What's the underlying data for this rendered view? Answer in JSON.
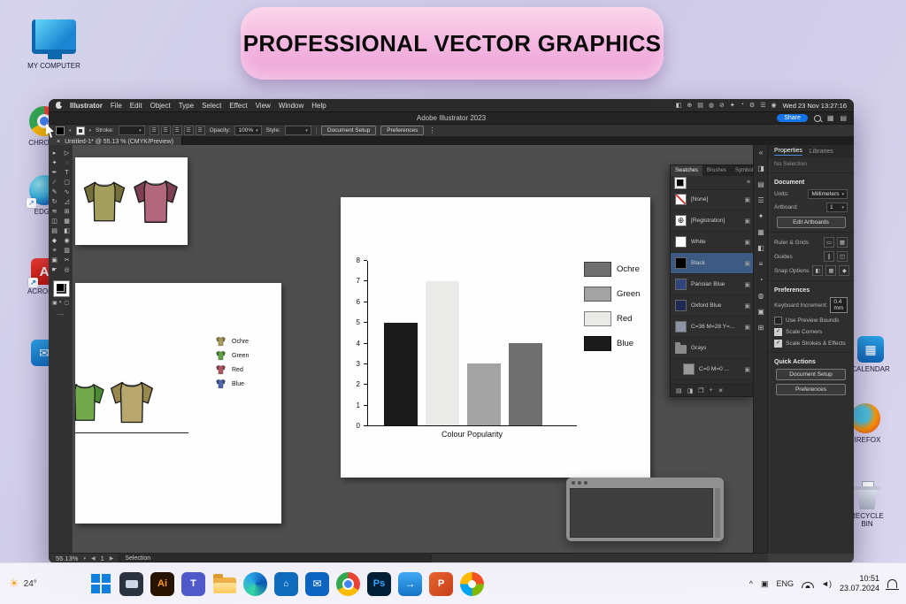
{
  "banner": {
    "title": "PROFESSIONAL VECTOR GRAPHICS"
  },
  "desktop": {
    "my_computer": "MY COMPUTER",
    "left_icons": [
      {
        "name": "chrome",
        "label": "CHROME"
      },
      {
        "name": "edge",
        "label": "EDGE"
      },
      {
        "name": "acrobat",
        "label": "ACROBAT"
      },
      {
        "name": "mail",
        "label": ""
      }
    ],
    "right_icons": [
      {
        "name": "calendar",
        "label": "CALENDAR"
      },
      {
        "name": "firefox",
        "label": "FIREFOX"
      },
      {
        "name": "recycle-bin",
        "label": "RECYCLE BIN"
      }
    ]
  },
  "menubar": {
    "items": [
      "Illustrator",
      "File",
      "Edit",
      "Object",
      "Type",
      "Select",
      "Effect",
      "View",
      "Window",
      "Help"
    ],
    "status_icons": [
      "◧",
      "⊕",
      "▤",
      "◍",
      "⊘",
      "✦",
      "◔",
      "⚙",
      "☰",
      "◉"
    ],
    "clock": "Wed 23 Nov 13:27:16"
  },
  "titlebar": {
    "title": "Adobe Illustrator 2023",
    "share": "Share"
  },
  "controlbar": {
    "stroke_label": "Stroke:",
    "opacity_label": "Opacity:",
    "opacity_value": "100%",
    "style_label": "Style:",
    "doc_setup": "Document Setup",
    "preferences": "Preferences"
  },
  "tab": {
    "close": "×",
    "title": "Untitled-1* @ 55.13 % (CMYK/Preview)"
  },
  "tools": [
    {
      "name": "selection",
      "glyph": "▸"
    },
    {
      "name": "direct-selection",
      "glyph": "▷"
    },
    {
      "name": "magic-wand",
      "glyph": "✦"
    },
    {
      "name": "lasso",
      "glyph": "◌"
    },
    {
      "name": "pen",
      "glyph": "✒"
    },
    {
      "name": "type",
      "glyph": "T"
    },
    {
      "name": "line-segment",
      "glyph": "∕"
    },
    {
      "name": "rectangle",
      "glyph": "▢"
    },
    {
      "name": "paintbrush",
      "glyph": "✎"
    },
    {
      "name": "shaper",
      "glyph": "∿"
    },
    {
      "name": "rotate",
      "glyph": "↻"
    },
    {
      "name": "scale",
      "glyph": "◿"
    },
    {
      "name": "width",
      "glyph": "≋"
    },
    {
      "name": "free-transform",
      "glyph": "⊞"
    },
    {
      "name": "shape-builder",
      "glyph": "◫"
    },
    {
      "name": "perspective-grid",
      "glyph": "▦"
    },
    {
      "name": "mesh",
      "glyph": "▤"
    },
    {
      "name": "gradient",
      "glyph": "◧"
    },
    {
      "name": "eyedropper",
      "glyph": "◆"
    },
    {
      "name": "blend",
      "glyph": "◉"
    },
    {
      "name": "symbol-sprayer",
      "glyph": "≡"
    },
    {
      "name": "column-graph",
      "glyph": "▥"
    },
    {
      "name": "artboard",
      "glyph": "▣"
    },
    {
      "name": "slice",
      "glyph": "✂"
    },
    {
      "name": "hand",
      "glyph": "☛"
    },
    {
      "name": "zoom",
      "glyph": "◎"
    }
  ],
  "dock_icons": [
    {
      "name": "collapse-dock-icon",
      "glyph": "«"
    },
    {
      "name": "color-panel-icon",
      "glyph": "◨"
    },
    {
      "name": "color-guide-panel-icon",
      "glyph": "▤"
    },
    {
      "name": "properties-panel-icon",
      "glyph": "☰"
    },
    {
      "name": "brushes-panel-icon",
      "glyph": "✦"
    },
    {
      "name": "swatches-panel-icon",
      "glyph": "▦"
    },
    {
      "name": "symbols-panel-icon",
      "glyph": "◧"
    },
    {
      "name": "stroke-panel-icon",
      "glyph": "≡"
    },
    {
      "name": "gradient-panel-icon",
      "glyph": "◔"
    },
    {
      "name": "transparency-panel-icon",
      "glyph": "◍"
    },
    {
      "name": "appearance-panel-icon",
      "glyph": "▣"
    },
    {
      "name": "layers-panel-icon",
      "glyph": "⊞"
    }
  ],
  "swatches": {
    "tabs": [
      "Swatches",
      "Brushes",
      "Symbols"
    ],
    "active_tab": "Swatches",
    "rows": [
      {
        "name": "[None]",
        "type": "none"
      },
      {
        "name": "[Registration]",
        "type": "registration"
      },
      {
        "name": "White",
        "type": "color",
        "color": "#ffffff"
      },
      {
        "name": "Black",
        "type": "color",
        "color": "#000000",
        "selected": true
      },
      {
        "name": "Parisian Blue",
        "type": "color",
        "color": "#30457c"
      },
      {
        "name": "Oxford Blue",
        "type": "color",
        "color": "#1e2b55"
      },
      {
        "name": "C=36 M=28 Y=...",
        "type": "color",
        "color": "#8b93a6"
      },
      {
        "name": "Grays",
        "type": "folder"
      },
      {
        "name": "C=0 M=0 ...",
        "type": "color",
        "color": "#9a9a9a",
        "indent": true
      }
    ],
    "footer_icons": [
      "▤",
      "◨",
      "❐",
      "+",
      "✕"
    ]
  },
  "properties": {
    "tabs": [
      "Properties",
      "Libraries"
    ],
    "selection_status": "No Selection",
    "section_document": "Document",
    "units_label": "Units:",
    "units_value": "Millimeters",
    "artboard_label": "Artboard:",
    "artboard_value": "1",
    "edit_artboards": "Edit Artboards",
    "ruler_grids": "Ruler & Grids",
    "guides": "Guides",
    "snap_options": "Snap Options",
    "section_preferences": "Preferences",
    "keyboard_increment_label": "Keyboard Increment:",
    "keyboard_increment_value": "0.4 mm",
    "checkboxes": [
      {
        "label": "Use Preview Bounds",
        "checked": false
      },
      {
        "label": "Scale Corners",
        "checked": true
      },
      {
        "label": "Scale Strokes & Effects",
        "checked": true
      }
    ],
    "section_quick_actions": "Quick Actions",
    "quick_actions": [
      "Document Setup",
      "Preferences"
    ]
  },
  "statusbar": {
    "zoom": "55.13%",
    "artboard": "1",
    "tool": "Selection"
  },
  "chart_data": {
    "type": "bar",
    "title": "",
    "xlabel": "Colour Popularity",
    "ylabel": "",
    "ylim": [
      0,
      8
    ],
    "yticks": [
      0,
      1,
      2,
      3,
      4,
      5,
      6,
      7,
      8
    ],
    "categories": [
      "Blue",
      "Red",
      "Green",
      "Ochre"
    ],
    "values": [
      5,
      7,
      3,
      4
    ],
    "bar_colors": [
      "#1b1b1b",
      "#eaeae8",
      "#a3a3a3",
      "#6f6f6f"
    ],
    "legend": [
      {
        "label": "Ochre",
        "color": "#6f6f6f"
      },
      {
        "label": "Green",
        "color": "#a3a3a3"
      },
      {
        "label": "Red",
        "color": "#eaeae8"
      },
      {
        "label": "Blue",
        "color": "#1b1b1b"
      }
    ],
    "legend_position": "right",
    "grid": false
  },
  "artboards": {
    "shirts_top": [
      {
        "name": "olive-shirt",
        "body": "#a59f5e",
        "sleeve": "#756f3d"
      },
      {
        "name": "maroon-shirt",
        "body": "#b2687c",
        "sleeve": "#7e4055"
      }
    ],
    "shirts_bottom": [
      {
        "name": "green-shirt",
        "body": "#72a94c",
        "sleeve": "#4c8a33"
      },
      {
        "name": "tan-shirt",
        "body": "#b7a76d",
        "sleeve": "#97874e"
      }
    ],
    "shirt_legend": [
      {
        "label": "Ochre",
        "body": "#a79a55",
        "sleeve": "#857941"
      },
      {
        "label": "Green",
        "body": "#62a247",
        "sleeve": "#3f7d2e"
      },
      {
        "label": "Red",
        "body": "#b05660",
        "sleeve": "#8c3a46"
      },
      {
        "label": "Blue",
        "body": "#4f63aa",
        "sleeve": "#36477e"
      }
    ]
  },
  "taskbar": {
    "weather_temp": "24°",
    "icons": [
      {
        "name": "start"
      },
      {
        "name": "search-dark"
      },
      {
        "name": "illustrator",
        "glyph": "Ai"
      },
      {
        "name": "teams",
        "glyph": "T"
      },
      {
        "name": "folder"
      },
      {
        "name": "edge"
      },
      {
        "name": "store",
        "glyph": "⌂"
      },
      {
        "name": "outlook",
        "glyph": "✉"
      },
      {
        "name": "chrome"
      },
      {
        "name": "photoshop",
        "glyph": "Ps"
      },
      {
        "name": "remote",
        "glyph": "→"
      },
      {
        "name": "powerpoint",
        "glyph": "P"
      },
      {
        "name": "photos"
      }
    ],
    "tray": {
      "expand": "^",
      "network_glyph": "▣",
      "language": "ENG",
      "volume_glyph": "◄)",
      "time": "10:51",
      "date": "23.07.2024"
    }
  }
}
